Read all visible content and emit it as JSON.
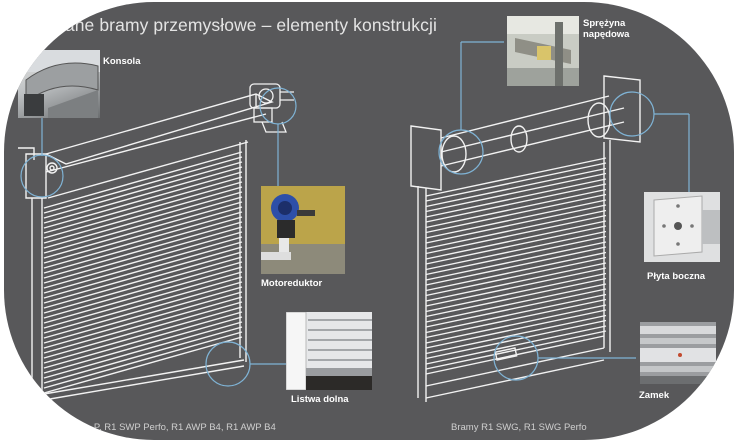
{
  "title": "...ane bramy przemysłowe – elementy konstrukcji",
  "labels": {
    "konsola": "Konsola",
    "motoreduktor": "Motoreduktor",
    "listwa_dolna": "Listwa dolna",
    "sprezyna_line1": "Sprężyna",
    "sprezyna_line2": "napędowa",
    "plyta_boczna": "Płyta boczna",
    "zamek": "Zamek"
  },
  "captions": {
    "left": "...P, R1 SWP Perfo, R1 AWP B4, R1 AWP B4",
    "right": "Bramy R1 SWG, R1 SWG Perfo"
  },
  "icons": [
    "gear-motor-icon",
    "spring-shaft-icon",
    "lock-icon"
  ],
  "colors": {
    "background": "#58585a",
    "outline": "#f2f2f2",
    "callout": "#7fb3d5"
  }
}
